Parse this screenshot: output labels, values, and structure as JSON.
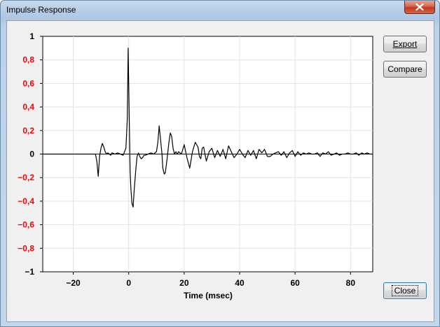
{
  "window": {
    "title": "Impulse Response"
  },
  "buttons": {
    "export": "Export",
    "compare": "Compare",
    "close": "Close"
  },
  "chart_data": {
    "type": "line",
    "xlabel": "Time (msec)",
    "ylabel": "",
    "xlim": [
      -31,
      88
    ],
    "ylim": [
      -1,
      1
    ],
    "x_ticks": [
      -20,
      0,
      20,
      40,
      60,
      80
    ],
    "y_ticks": [
      1,
      0.8,
      0.6,
      0.4,
      0.2,
      0,
      -0.2,
      -0.4,
      -0.6,
      -0.8,
      -1
    ],
    "x_tick_labels": [
      "−20",
      "0",
      "20",
      "40",
      "60",
      "80"
    ],
    "y_tick_labels": [
      "1",
      "0,8",
      "0,6",
      "0,4",
      "0,2",
      "0",
      "−0,2",
      "−0,4",
      "−0,6",
      "−0,8",
      "−1"
    ],
    "y_tick_label_colors": [
      "#000000",
      "#ff0000",
      "#ff0000",
      "#ff0000",
      "#ff0000",
      "#000000",
      "#ff0000",
      "#ff0000",
      "#ff0000",
      "#ff0000",
      "#000000"
    ],
    "grid": true,
    "line_color": "#000000",
    "series": [
      {
        "x": [
          -31,
          -12,
          -11.5,
          -11,
          -10.5,
          -10,
          -9.5,
          -9,
          -8.5,
          -8,
          -7.5,
          -7,
          -6.5,
          -6,
          -5,
          -4,
          -3,
          -2,
          -1,
          -0.5,
          -0.2,
          0,
          0.2,
          0.5,
          0.8,
          1.2,
          1.6,
          2,
          2.5,
          3,
          3.5,
          4,
          4.5,
          5,
          5.5,
          6,
          7,
          8,
          9,
          10,
          10.5,
          11,
          11.5,
          12,
          12.3,
          12.8,
          13.2,
          13.8,
          14.5,
          15,
          15.5,
          16,
          16.5,
          17,
          17.5,
          18,
          19,
          20,
          21,
          22,
          23,
          24,
          25,
          25.5,
          26,
          26.5,
          27,
          28,
          29,
          30,
          31,
          32,
          33,
          34,
          35,
          36,
          37,
          38,
          39,
          40,
          41,
          42,
          43,
          44,
          45,
          46,
          47,
          48,
          49,
          50,
          51,
          52,
          53,
          54,
          55,
          56,
          57,
          58,
          59,
          60,
          61,
          62,
          63,
          64,
          65,
          66,
          67,
          68,
          69,
          70,
          71,
          72,
          73,
          74,
          75,
          76,
          77,
          78,
          79,
          80,
          81,
          82,
          83,
          84,
          85,
          86,
          87,
          88
        ],
        "y": [
          0,
          0,
          -0.06,
          -0.19,
          -0.02,
          0.05,
          0.09,
          0.06,
          0.02,
          0,
          0.01,
          0,
          -0.01,
          0.01,
          0,
          0.01,
          0,
          -0.01,
          0.05,
          0.3,
          0.9,
          0.6,
          0.3,
          -0.15,
          -0.3,
          -0.42,
          -0.45,
          -0.3,
          -0.15,
          -0.02,
          0.01,
          -0.02,
          -0.04,
          -0.03,
          -0.01,
          -0.01,
          0,
          0.01,
          0,
          0.02,
          0.1,
          0.24,
          0.12,
          0,
          -0.12,
          -0.17,
          -0.16,
          -0.05,
          0.1,
          0.18,
          0.15,
          0.05,
          0,
          0.02,
          0,
          0.02,
          0,
          0.08,
          -0.03,
          -0.12,
          0.02,
          0.1,
          0.06,
          -0.02,
          -0.04,
          0.05,
          0.06,
          -0.06,
          0.02,
          0.05,
          -0.03,
          0.03,
          -0.02,
          0.04,
          -0.04,
          0.07,
          0.02,
          -0.03,
          0,
          0.04,
          0,
          -0.03,
          0.03,
          -0.01,
          0.03,
          -0.04,
          0.04,
          0.01,
          0.04,
          -0.02,
          -0.02,
          0,
          0.01,
          0.02,
          -0.01,
          0.02,
          -0.03,
          0.01,
          0.03,
          -0.02,
          0.02,
          -0.01,
          0.01,
          0,
          0.01,
          0,
          0,
          0.01,
          -0.02,
          0.01,
          0,
          0.02,
          -0.01,
          0,
          0.01,
          -0.01,
          0,
          0,
          0.01,
          0,
          0,
          0.01,
          -0.01,
          0.01,
          0,
          0.01,
          0,
          0
        ]
      }
    ]
  }
}
